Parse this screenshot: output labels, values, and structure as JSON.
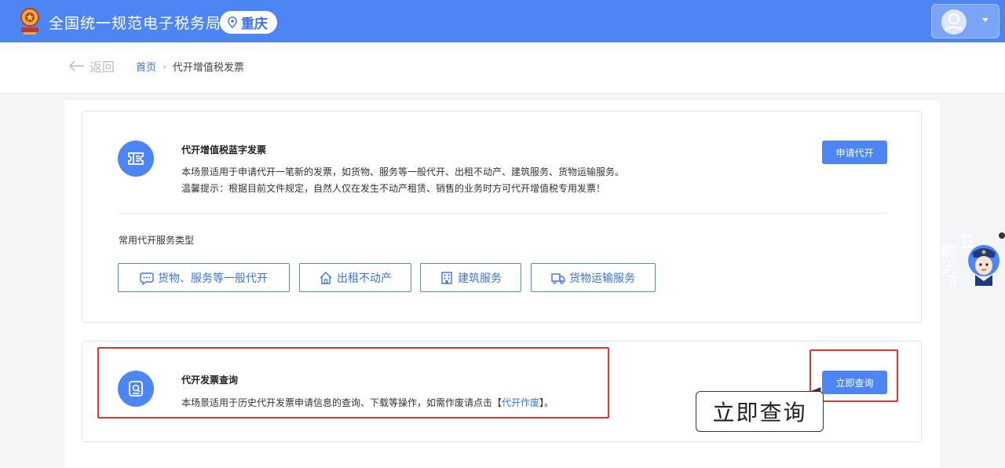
{
  "header": {
    "site_title": "全国统一规范电子税务局",
    "region": "重庆",
    "colors": {
      "brand": "#4d86f4"
    }
  },
  "breadcrumb": {
    "back_label": "返回",
    "home": "首页",
    "current": "代开增值税发票"
  },
  "card_blue_invoice": {
    "title": "代开增值税蓝字发票",
    "description": "本场景适用于申请代开一笔新的发票，如货物、服务等一般代开、出租不动产、建筑服务、货物运输服务。",
    "tip": "温馨提示：根据目前文件规定，自然人仅在发生不动产租赁、销售的业务时方可代开增值税专用发票！",
    "action_label": "申请代开",
    "types_label": "常用代开服务类型",
    "types": [
      {
        "label": "货物、服务等一般代开",
        "icon": "chat-bubble-icon"
      },
      {
        "label": "出租不动产",
        "icon": "house-icon"
      },
      {
        "label": "建筑服务",
        "icon": "building-icon"
      },
      {
        "label": "货物运输服务",
        "icon": "truck-icon"
      }
    ]
  },
  "card_query": {
    "title": "代开发票查询",
    "description_prefix": "本场景适用于历史代开发票申请信息的查询、下载等操作，如需作废请点击【",
    "description_link": "代开作废",
    "description_suffix": "】。",
    "action_label": "立即查询"
  },
  "annotation": {
    "callout": "立即查询",
    "highlight_color": "#e8322c"
  },
  "widget": {
    "chars": [
      "征",
      "纳",
      "互",
      "动"
    ]
  }
}
